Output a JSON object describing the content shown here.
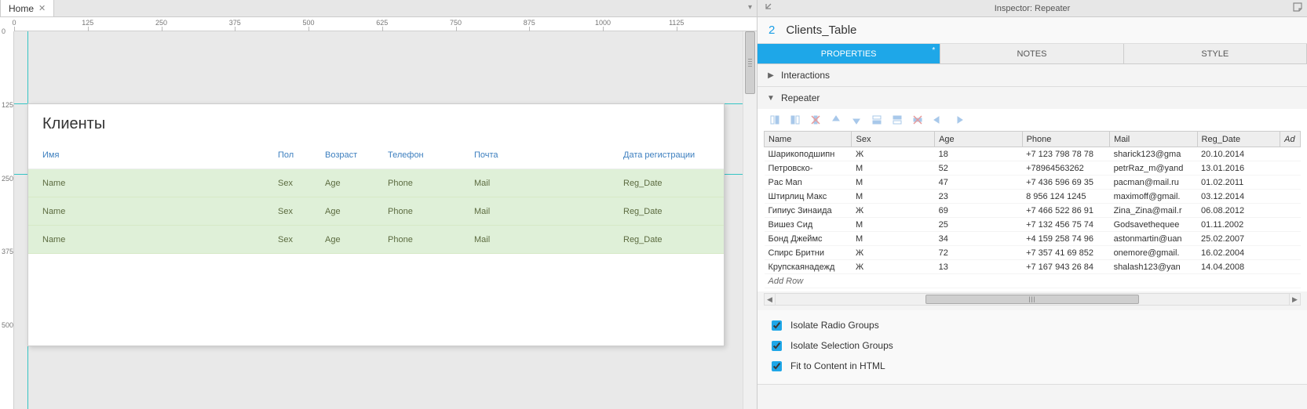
{
  "tab": {
    "title": "Home"
  },
  "ruler_h": [
    0,
    125,
    250,
    375,
    500,
    625,
    750,
    875,
    1000,
    1125
  ],
  "ruler_v": [
    0,
    125,
    250,
    375,
    500
  ],
  "canvas": {
    "heading": "Клиенты",
    "headers": {
      "name": "Имя",
      "sex": "Пол",
      "age": "Возраст",
      "phone": "Телефон",
      "mail": "Почта",
      "date": "Дата регистрации"
    },
    "placeholder": {
      "name": "Name",
      "sex": "Sex",
      "age": "Age",
      "phone": "Phone",
      "mail": "Mail",
      "date": "Reg_Date"
    }
  },
  "inspector": {
    "title": "Inspector: Repeater",
    "index": "2",
    "object_name": "Clients_Table",
    "tabs": {
      "props": "PROPERTIES",
      "notes": "NOTES",
      "style": "STYLE"
    },
    "sections": {
      "interactions": "Interactions",
      "repeater": "Repeater"
    },
    "grid": {
      "columns": [
        "Name",
        "Sex",
        "Age",
        "Phone",
        "Mail",
        "Reg_Date"
      ],
      "addcol": "Ad",
      "rows": [
        {
          "name": "Шарикоподшипн",
          "sex": "Ж",
          "age": "18",
          "phone": "+7 123 798 78 78",
          "mail": "sharick123@gma",
          "date": "20.10.2014"
        },
        {
          "name": "Петровско-",
          "sex": "М",
          "age": "52",
          "phone": "+78964563262",
          "mail": "petrRaz_m@yand",
          "date": "13.01.2016"
        },
        {
          "name": "Pac Man",
          "sex": "М",
          "age": "47",
          "phone": "+7 436 596 69 35",
          "mail": "pacman@mail.ru",
          "date": "01.02.2011"
        },
        {
          "name": "Штирлиц Макс",
          "sex": "М",
          "age": "23",
          "phone": "8 956 124 1245",
          "mail": "maximoff@gmail.",
          "date": "03.12.2014"
        },
        {
          "name": "Гипиус Зинаида",
          "sex": "Ж",
          "age": "69",
          "phone": "+7 466 522 86 91",
          "mail": "Zina_Zina@mail.r",
          "date": "06.08.2012"
        },
        {
          "name": "Вишез Сид",
          "sex": "М",
          "age": "25",
          "phone": "+7 132 456 75 74",
          "mail": "Godsavethequee",
          "date": "01.11.2002"
        },
        {
          "name": "Бонд Джеймс",
          "sex": "М",
          "age": "34",
          "phone": "+4 159 258 74 96",
          "mail": "astonmartin@uan",
          "date": "25.02.2007"
        },
        {
          "name": "Спирс Бритни",
          "sex": "Ж",
          "age": "72",
          "phone": "+7 357 41 69 852",
          "mail": "onemore@gmail.",
          "date": "16.02.2004"
        },
        {
          "name": "Крупскаянадежд",
          "sex": "Ж",
          "age": "13",
          "phone": "+7 167 943 26 84",
          "mail": "shalash123@yan",
          "date": "14.04.2008"
        }
      ],
      "addrow": "Add Row"
    },
    "checks": {
      "radio": "Isolate Radio Groups",
      "selection": "Isolate Selection Groups",
      "fit": "Fit to Content in HTML"
    }
  }
}
